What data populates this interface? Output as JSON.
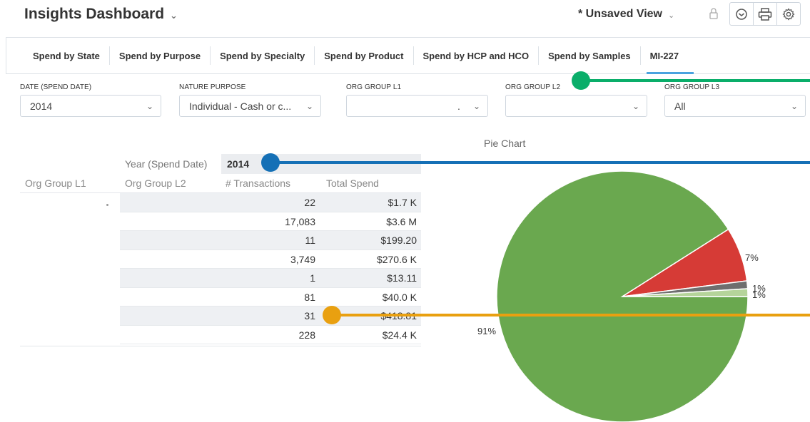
{
  "header": {
    "title": "Insights Dashboard",
    "view_label": "* Unsaved View",
    "icons": [
      "lock-icon",
      "clock-icon",
      "print-icon",
      "gear-icon"
    ]
  },
  "tabs": [
    {
      "label": "Spend by State"
    },
    {
      "label": "Spend by Purpose"
    },
    {
      "label": "Spend by Specialty"
    },
    {
      "label": "Spend by Product"
    },
    {
      "label": "Spend by HCP and HCO"
    },
    {
      "label": "Spend by Samples"
    },
    {
      "label": "MI-227"
    }
  ],
  "filters": [
    {
      "label": "DATE (SPEND DATE)",
      "value": "2014"
    },
    {
      "label": "NATURE PURPOSE",
      "value": "Individual - Cash or c..."
    },
    {
      "label": "ORG GROUP L1",
      "value": "."
    },
    {
      "label": "ORG GROUP L2",
      "value": ""
    },
    {
      "label": "ORG GROUP L3",
      "value": "All"
    }
  ],
  "table": {
    "year_label": "Year (Spend Date)",
    "year_value": "2014",
    "headers": [
      "Org Group L1",
      "Org Group L2",
      "# Transactions",
      "Total Spend"
    ],
    "rows": [
      {
        "txn": "22",
        "spend": "$1.7 K"
      },
      {
        "txn": "17,083",
        "spend": "$3.6 M"
      },
      {
        "txn": "11",
        "spend": "$199.20"
      },
      {
        "txn": "3,749",
        "spend": "$270.6 K"
      },
      {
        "txn": "1",
        "spend": "$13.11"
      },
      {
        "txn": "81",
        "spend": "$40.0 K"
      },
      {
        "txn": "31",
        "spend": "$418.81"
      },
      {
        "txn": "228",
        "spend": "$24.4 K"
      }
    ]
  },
  "chart_data": {
    "type": "pie",
    "title": "Pie Chart",
    "slices": [
      {
        "value": 91,
        "label": "91%",
        "color": "#6aa84f"
      },
      {
        "value": 7,
        "label": "7%",
        "color": "#d63b36"
      },
      {
        "value": 1,
        "label": "1%",
        "color": "#6e6e6e"
      },
      {
        "value": 1,
        "label": "1%",
        "color": "#b5d49a"
      }
    ]
  },
  "colors": {
    "callout_green": "#0aae6a",
    "callout_blue": "#1570b6",
    "callout_orange": "#e9a010",
    "tab_underline": "#4aa3df"
  }
}
